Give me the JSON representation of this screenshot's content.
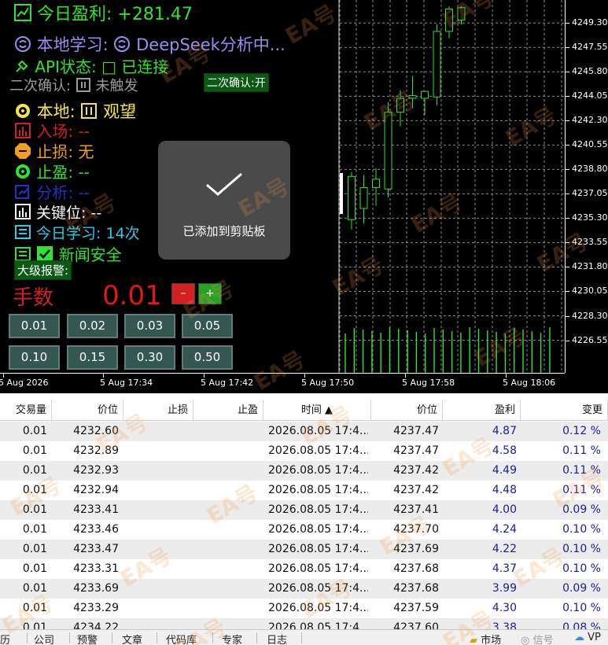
{
  "panel": {
    "profit_label": "今日盈利: +281.47",
    "ai_label_prefix": "本地学习:",
    "ai_label_value": "DeepSeek分析中...",
    "api_label": "API状态: □ 已连接",
    "confirm_label": "二次确认:",
    "confirm_value": "未触发",
    "confirm_toggle": "二次确认:开",
    "local_label": "本地:",
    "local_value": "观望",
    "entry_label": "入场: --",
    "stoploss_label": "止损: 无",
    "takeprofit_label": "止盈: --",
    "analysis_label": "分析: --",
    "keylevel_label": "关键位: --",
    "learn_label": "今日学习: 14次",
    "news_label": "新闻安全",
    "alert_label": "大级报警:",
    "lots_label": "手数",
    "lots_value": "0.01",
    "minus_label": "–",
    "plus_label": "+",
    "lot_buttons": [
      "0.01",
      "0.02",
      "0.03",
      "0.05",
      "0.10",
      "0.15",
      "0.30",
      "0.50"
    ]
  },
  "toast": {
    "text": "已添加到剪贴板",
    "icon": "checkmark-icon"
  },
  "chart": {
    "price_labels": [
      "4249.30",
      "4247.55",
      "4245.80",
      "4244.05",
      "4242.30",
      "4240.55",
      "4238.80",
      "4237.05",
      "4235.30",
      "4233.55",
      "4231.80",
      "4230.05",
      "4228.30",
      "4226.55"
    ],
    "time_labels": [
      "5 Aug 2026",
      "5 Aug 17:34",
      "5 Aug 17:42",
      "5 Aug 17:50",
      "5 Aug 17:58",
      "5 Aug 18:06"
    ],
    "colors": {
      "bull": "#2ee52e",
      "grid": "#8a8a8a",
      "bg": "#000000"
    }
  },
  "chart_data": {
    "type": "candlestick",
    "title": "",
    "ylim": [
      4225.0,
      4250.5
    ],
    "candles": [
      {
        "o": 4235.2,
        "h": 4238.6,
        "l": 4234.5,
        "c": 4238.3
      },
      {
        "o": 4236.0,
        "h": 4238.4,
        "l": 4234.9,
        "c": 4237.5
      },
      {
        "o": 4237.5,
        "h": 4238.9,
        "l": 4236.2,
        "c": 4238.1
      },
      {
        "o": 4237.4,
        "h": 4243.6,
        "l": 4236.8,
        "c": 4242.9
      },
      {
        "o": 4242.9,
        "h": 4244.5,
        "l": 4241.9,
        "c": 4243.9
      },
      {
        "o": 4243.9,
        "h": 4245.5,
        "l": 4243.2,
        "c": 4244.1
      },
      {
        "o": 4243.9,
        "h": 4244.3,
        "l": 4242.7,
        "c": 4244.4
      },
      {
        "o": 4244.0,
        "h": 4249.2,
        "l": 4243.4,
        "c": 4248.7
      },
      {
        "o": 4248.7,
        "h": 4250.5,
        "l": 4248.2,
        "c": 4250.3
      },
      {
        "o": 4249.5,
        "h": 4250.5,
        "l": 4249.2,
        "c": 4250.4
      }
    ],
    "volume_bars": 24
  },
  "table": {
    "headers": [
      "交易量",
      "价位",
      "止损",
      "止盈",
      "时间 ▲",
      "价位",
      "盈利",
      "变更"
    ],
    "rows": [
      [
        "0.01",
        "4232.60",
        "",
        "",
        "2026.08.05 17:4...",
        "4237.47",
        "4.87",
        "0.12 %"
      ],
      [
        "0.01",
        "4232.89",
        "",
        "",
        "2026.08.05 17:4...",
        "4237.47",
        "4.58",
        "0.11 %"
      ],
      [
        "0.01",
        "4232.93",
        "",
        "",
        "2026.08.05 17:4...",
        "4237.42",
        "4.49",
        "0.11 %"
      ],
      [
        "0.01",
        "4232.94",
        "",
        "",
        "2026.08.05 17:4...",
        "4237.42",
        "4.48",
        "0.11 %"
      ],
      [
        "0.01",
        "4233.41",
        "",
        "",
        "2026.08.05 17:4...",
        "4237.41",
        "4.00",
        "0.09 %"
      ],
      [
        "0.01",
        "4233.46",
        "",
        "",
        "2026.08.05 17:4...",
        "4237.70",
        "4.24",
        "0.10 %"
      ],
      [
        "0.01",
        "4233.47",
        "",
        "",
        "2026.08.05 17:4...",
        "4237.69",
        "4.22",
        "0.10 %"
      ],
      [
        "0.01",
        "4233.31",
        "",
        "",
        "2026.08.05 17:4...",
        "4237.68",
        "4.37",
        "0.10 %"
      ],
      [
        "0.01",
        "4233.69",
        "",
        "",
        "2026.08.05 17:4...",
        "4237.68",
        "3.99",
        "0.09 %"
      ],
      [
        "0.01",
        "4233.29",
        "",
        "",
        "2026.08.05 17:4...",
        "4237.59",
        "4.30",
        "0.10 %"
      ],
      [
        "0.01",
        "4234.22",
        "",
        "",
        "2026.08.05 17:4...",
        "4237.60",
        "3.38",
        "0.08 %"
      ]
    ]
  },
  "tabs": [
    "历",
    "公司",
    "预警",
    "文章",
    "代码库",
    "专家",
    "日志",
    "市场",
    "信号",
    "VP"
  ],
  "watermark": "EA号"
}
